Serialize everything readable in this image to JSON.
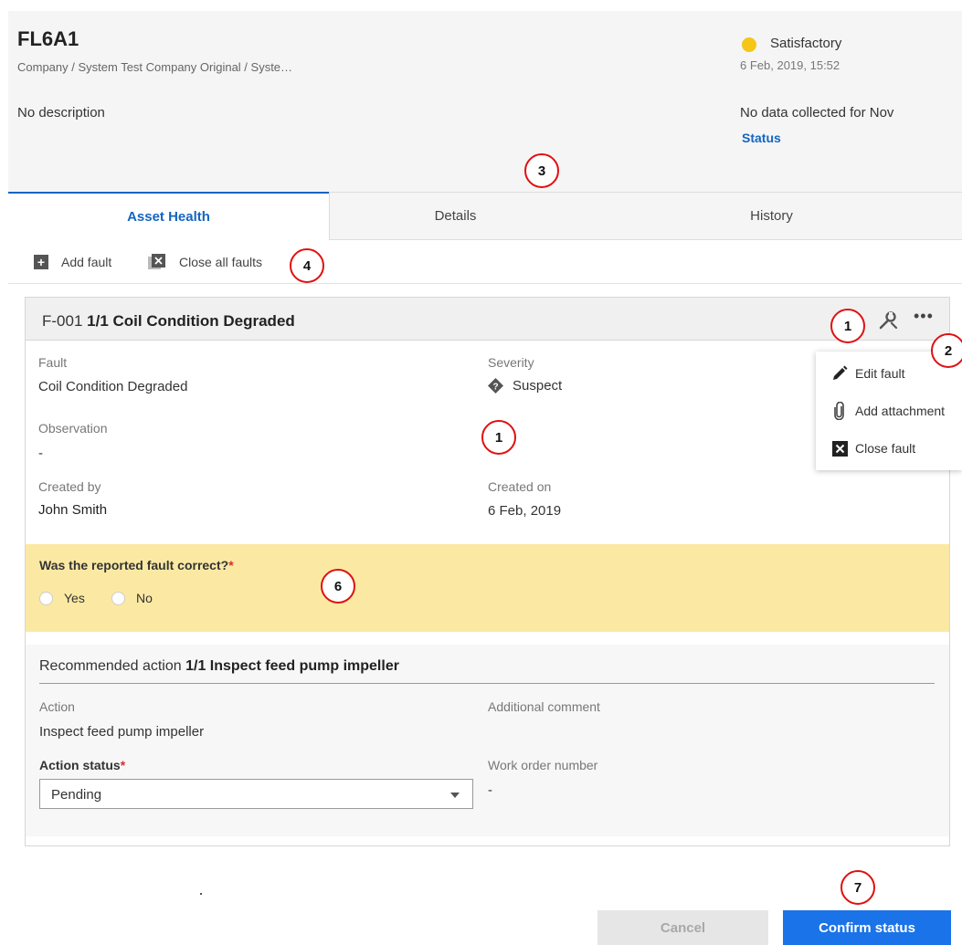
{
  "header": {
    "asset_id": "FL6A1",
    "breadcrumb": "Company / System Test Company Original / Syste…",
    "description": "No description",
    "status_label": "Satisfactory",
    "status_color": "#f5c518",
    "status_date": "6 Feb, 2019, 15:52",
    "no_data_text": "No data collected for Nov",
    "status_link": "Status"
  },
  "tabs": [
    {
      "label": "Asset Health",
      "active": true
    },
    {
      "label": "Details",
      "active": false
    },
    {
      "label": "History",
      "active": false
    }
  ],
  "toolbar": {
    "add_fault": "Add fault",
    "close_all": "Close all faults"
  },
  "fault": {
    "id": "F-001",
    "title": "1/1 Coil Condition Degraded",
    "fault_label": "Fault",
    "fault_value": "Coil Condition Degraded",
    "severity_label": "Severity",
    "severity_value": "Suspect",
    "observation_label": "Observation",
    "observation_value": "-",
    "created_by_label": "Created by",
    "created_by_value": "John Smith",
    "created_on_label": "Created on",
    "created_on_value": "6 Feb, 2019"
  },
  "question": {
    "text": "Was the reported fault correct?",
    "required_mark": "*",
    "yes": "Yes",
    "no": "No"
  },
  "recommended": {
    "prefix": "Recommended action",
    "title": "1/1 Inspect feed pump impeller",
    "action_label": "Action",
    "action_value": "Inspect feed pump impeller",
    "additional_comment_label": "Additional comment",
    "action_status_label": "Action status",
    "required_mark": "*",
    "action_status_value": "Pending",
    "work_order_label": "Work order number",
    "work_order_value": "-"
  },
  "menu": {
    "edit": "Edit fault",
    "attach": "Add attachment",
    "close": "Close fault"
  },
  "buttons": {
    "cancel": "Cancel",
    "confirm": "Confirm status"
  },
  "callouts": {
    "c1_head": "1",
    "c2": "2",
    "c3": "3",
    "c4": "4",
    "c1_body": "1",
    "c6": "6",
    "c7": "7"
  },
  "colors": {
    "accent": "#1565c0",
    "confirm_button": "#1a73e8",
    "question_band": "#fbe9a3",
    "callout_ring": "#e01010"
  },
  "icons": {
    "add_fault": "plus-square-icon",
    "close_all": "close-all-icon",
    "tools": "wrench-icon",
    "more": "ellipsis-icon",
    "severity": "diamond-question-icon",
    "edit": "pencil-icon",
    "attach": "paperclip-icon",
    "close": "close-box-icon",
    "dropdown": "caret-down-icon"
  }
}
